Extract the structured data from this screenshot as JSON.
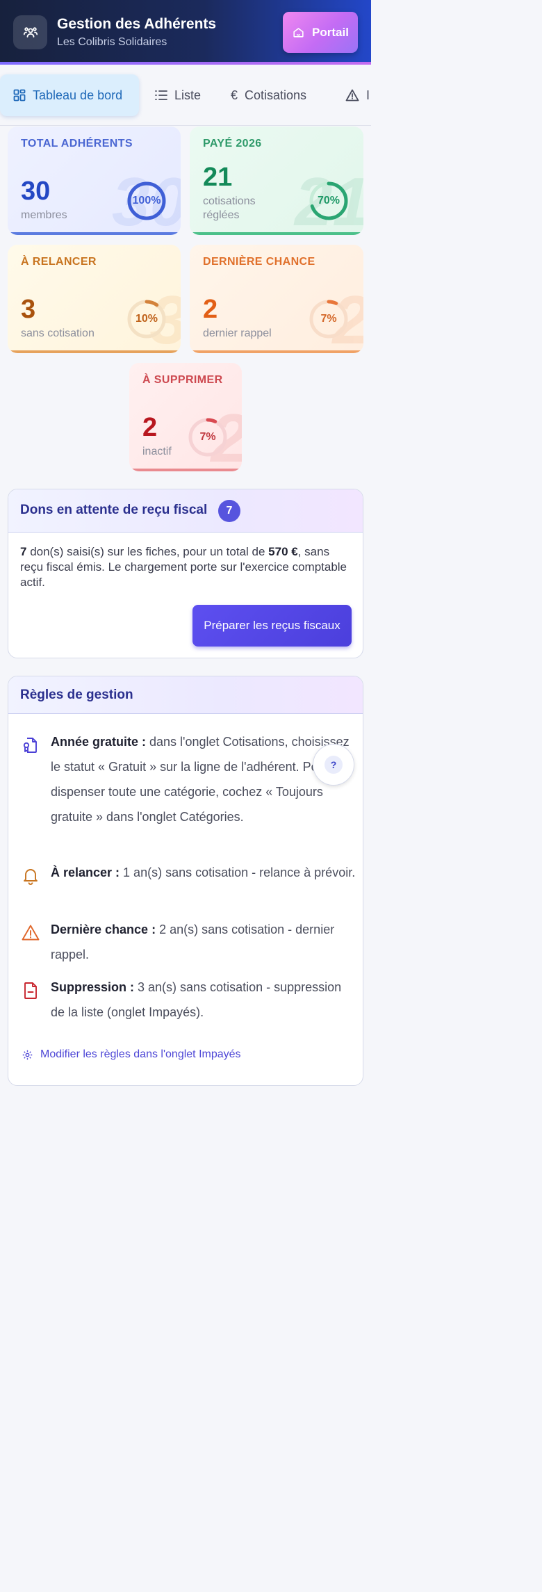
{
  "header": {
    "title": "Gestion des Adhérents",
    "subtitle": "Les Colibris Solidaires",
    "portal_label": "Portail",
    "logo_icon": "users-icon",
    "portal_icon": "home-icon"
  },
  "tabs": [
    {
      "label": "Tableau de bord",
      "icon": "dashboard-icon",
      "active": true
    },
    {
      "label": "Liste",
      "icon": "list-icon"
    },
    {
      "label": "Cotisations",
      "icon": "euro-icon"
    },
    {
      "label": "I",
      "icon": "warning-icon"
    }
  ],
  "stats": {
    "total": {
      "label": "TOTAL ADHÉRENTS",
      "value": "30",
      "unit": "membres",
      "percent": 100,
      "percent_label": "100%",
      "color": "#3f5fd6"
    },
    "paid": {
      "label": "PAYÉ 2026",
      "value": "21",
      "unit": "cotisations réglées",
      "percent": 70,
      "percent_label": "70%",
      "color": "#1e9866"
    },
    "remind": {
      "label": "À RELANCER",
      "value": "3",
      "unit": "sans cotisation",
      "percent": 10,
      "percent_label": "10%",
      "color": "#b85c10"
    },
    "last_chance": {
      "label": "DERNIÈRE CHANCE",
      "value": "2",
      "unit": "dernier rappel",
      "percent": 7,
      "percent_label": "7%",
      "color": "#e25f16"
    },
    "delete": {
      "label": "À SUPPRIMER",
      "value": "2",
      "unit": "inactif",
      "percent": 7,
      "percent_label": "7%",
      "color": "#c1262e"
    }
  },
  "donations": {
    "title": "Dons en attente de reçu fiscal",
    "badge": "7",
    "count": "7",
    "text_1": " don(s) saisi(s) sur les fiches, pour un total de ",
    "amount": "570 €",
    "text_2": ", sans reçu fiscal émis. Le chargement porte sur l'exercice comptable actif.",
    "button_label": "Préparer les reçus fiscaux"
  },
  "rules": {
    "title": "Règles de gestion",
    "help_label": "?",
    "items": [
      {
        "title": "Année gratuite :",
        "text": " dans l'onglet Cotisations, choisissez le statut « Gratuit » sur la ligne de l'adhérent. Pour dispenser toute une catégorie, cochez « Toujours gratuite » dans l'onglet Catégories.",
        "icon": "free-badge-icon"
      },
      {
        "title": "À relancer :",
        "text": " 1 an(s) sans cotisation - relance à prévoir.",
        "icon": "bell-icon"
      },
      {
        "title": "Dernière chance :",
        "text": " 2 an(s) sans cotisation - dernier rappel.",
        "icon": "warning-icon"
      },
      {
        "title": "Suppression :",
        "text": " 3 an(s) sans cotisation - suppression de la liste (onglet Impayés).",
        "icon": "file-remove-icon"
      }
    ],
    "edit_link": "Modifier les règles dans l'onglet Impayés"
  }
}
